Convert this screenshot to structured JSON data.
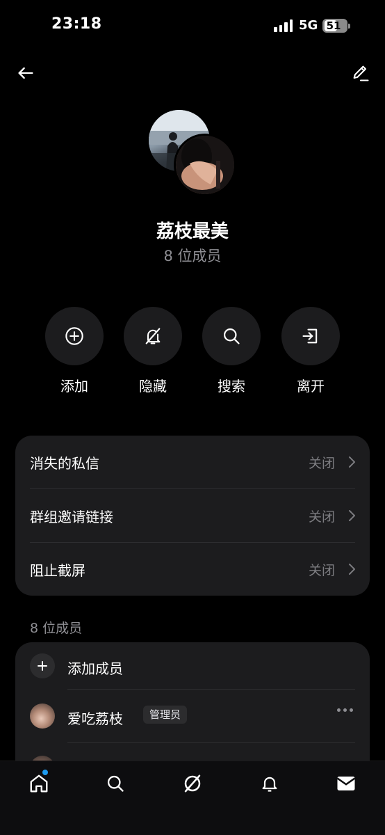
{
  "status_bar": {
    "time": "23:18",
    "network": "5G",
    "battery": "51"
  },
  "header": {
    "back_icon": "arrow-left-icon",
    "edit_icon": "pencil-icon"
  },
  "group": {
    "name": "荔枝最美",
    "member_count": "8 位成员"
  },
  "actions": [
    {
      "label": "添加",
      "icon": "plus-circle-icon"
    },
    {
      "label": "隐藏",
      "icon": "bell-off-icon"
    },
    {
      "label": "搜索",
      "icon": "search-icon"
    },
    {
      "label": "离开",
      "icon": "leave-icon"
    }
  ],
  "settings": [
    {
      "label": "消失的私信",
      "value": "关闭"
    },
    {
      "label": "群组邀请链接",
      "value": "关闭"
    },
    {
      "label": "阻止截屏",
      "value": "关闭"
    }
  ],
  "members_section": {
    "title": "8 位成员",
    "add_label": "添加成员",
    "members": [
      {
        "name": "爱吃荔枝",
        "badge": "管理员"
      }
    ]
  },
  "tabbar": {
    "items": [
      "home-icon",
      "search-icon",
      "grok-icon",
      "bell-icon",
      "mail-icon"
    ],
    "accent": "#1d9bf0"
  }
}
